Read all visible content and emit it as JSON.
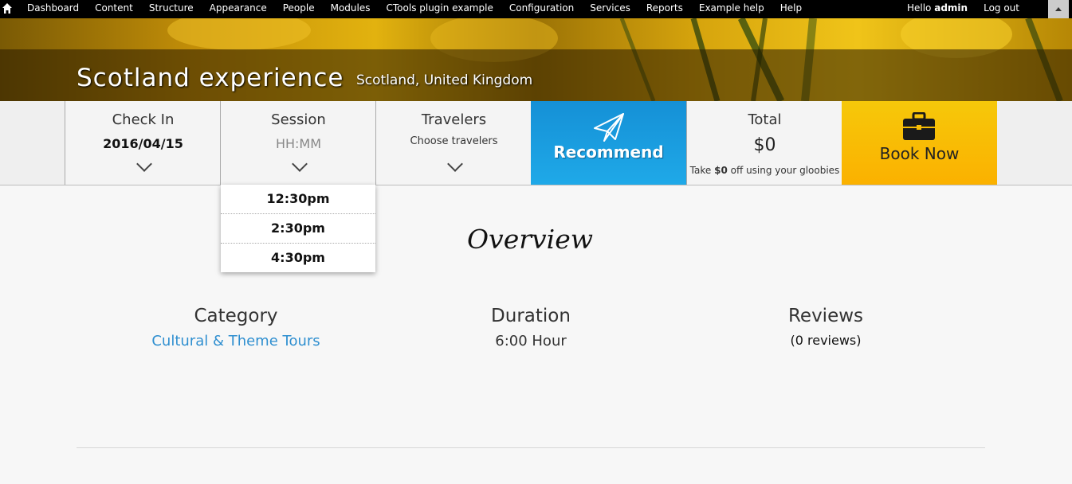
{
  "toolbar": {
    "menu": [
      "Dashboard",
      "Content",
      "Structure",
      "Appearance",
      "People",
      "Modules",
      "CTools plugin example",
      "Configuration",
      "Services",
      "Reports",
      "Example help",
      "Help"
    ],
    "greeting": "Hello",
    "user": "admin",
    "logout": "Log out"
  },
  "hero": {
    "title": "Scotland experience",
    "location": "Scotland, United Kingdom"
  },
  "booking": {
    "checkin_label": "Check In",
    "checkin_value": "2016/04/15",
    "session_label": "Session",
    "session_placeholder": "HH:MM",
    "travelers_label": "Travelers",
    "travelers_hint": "Choose travelers",
    "recommend_label": "Recommend",
    "total_label": "Total",
    "total_value": "$0",
    "total_note_prefix": "Take",
    "total_note_amount": "$0",
    "total_note_suffix": "off using your gloobies",
    "book_label": "Book Now"
  },
  "session_options": [
    "12:30pm",
    "2:30pm",
    "4:30pm"
  ],
  "overview": {
    "title": "Overview",
    "category_label": "Category",
    "category_value": "Cultural & Theme Tours",
    "duration_label": "Duration",
    "duration_value": "6:00 Hour",
    "reviews_label": "Reviews",
    "reviews_value": "(0 reviews)"
  },
  "colors": {
    "recommend": "#1fa0e0",
    "book": "#f7bd05",
    "link": "#2f8fd0"
  }
}
